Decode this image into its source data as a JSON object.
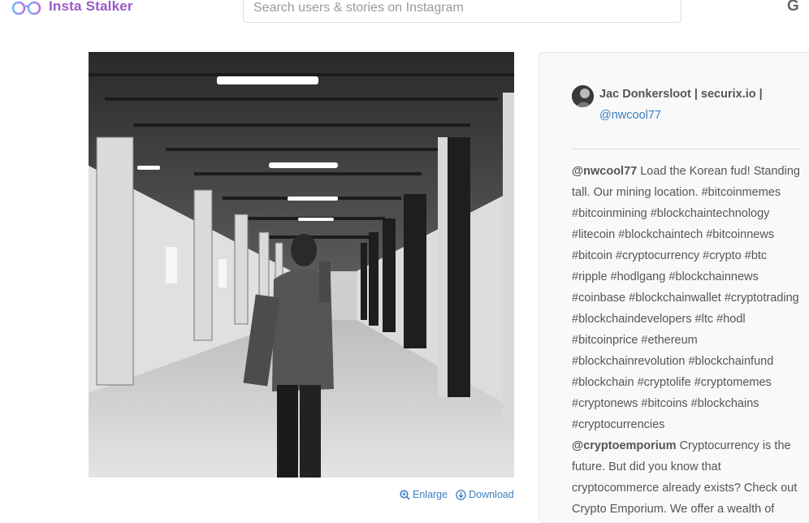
{
  "app": {
    "name": "Insta Stalker",
    "logo_icon": "glasses-icon"
  },
  "search": {
    "placeholder": "Search users & stories on Instagram"
  },
  "header_right": {
    "label": "G",
    "icon": "google-icon"
  },
  "photo": {
    "alt": "Man on phone walking in empty warehouse",
    "actions": {
      "enlarge": "Enlarge",
      "download": "Download"
    }
  },
  "author": {
    "name": "Jac Donkersloot | securix.io |",
    "handle": "@nwcool77"
  },
  "caption": [
    {
      "user": "@nwcool77",
      "text": " Load the Korean fud! Standing tall. Our mining location. #bitcoinmemes #bitcoinmining #blockchaintechnology #litecoin #blockchaintech #bitcoinnews #bitcoin #cryptocurrency #crypto #btc #ripple #hodlgang #blockchainnews #coinbase #blockchainwallet #cryptotrading #blockchaindevelopers #ltc #hodl #bitcoinprice #ethereum #blockchainrevolution #blockchainfund #blockchain #cryptolife #cryptomemes #cryptonews #bitcoins #blockchains #cryptocurrencies"
    },
    {
      "user": "@cryptoemporium",
      "text": " Cryptocurrency is the future. But did you know that cryptocommerce already exists? Check out Crypto Emporium. We offer a wealth of"
    }
  ],
  "colors": {
    "brand": "#9b59c9",
    "link": "#3a7fc4",
    "text": "#555555"
  }
}
